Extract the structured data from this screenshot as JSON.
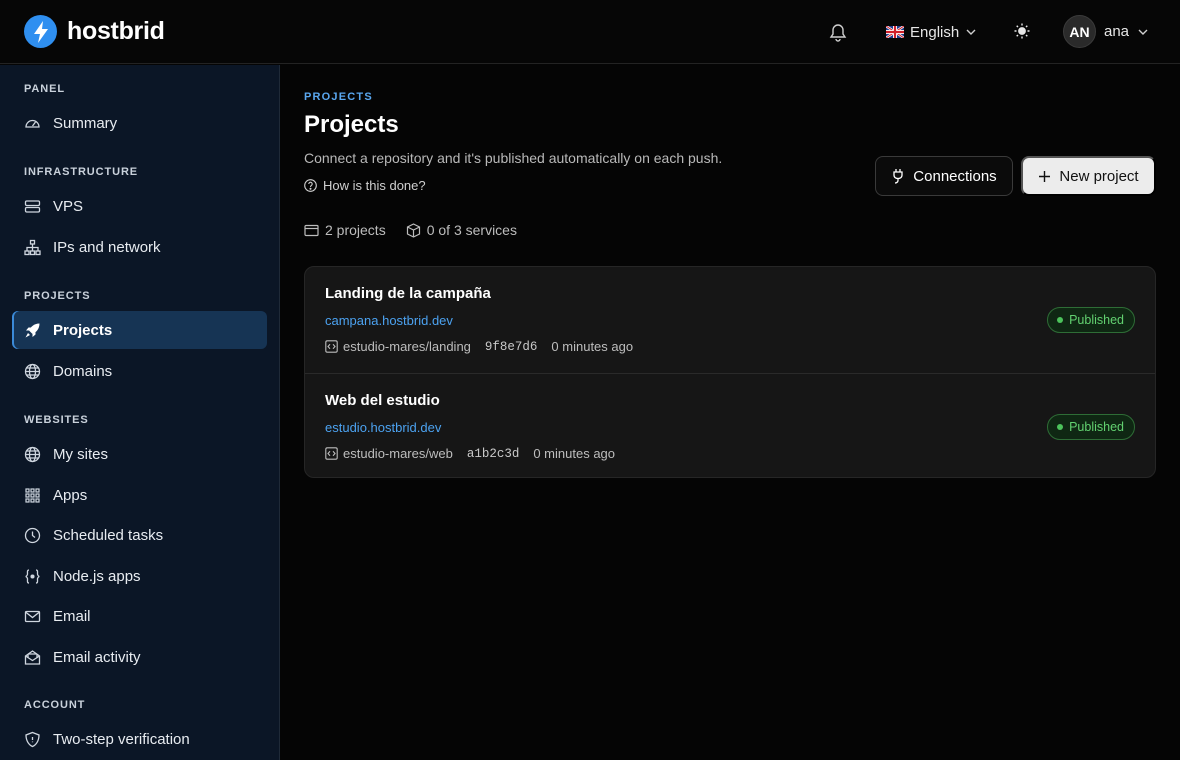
{
  "brand": {
    "name": "hostbrid",
    "color": "#2f8ff0"
  },
  "header": {
    "language": "English",
    "user_initials": "AN",
    "user_name": "ana"
  },
  "sidebar": {
    "sections": [
      {
        "title": "PANEL",
        "items": [
          {
            "label": "Summary",
            "icon": "gauge-icon"
          }
        ]
      },
      {
        "title": "INFRASTRUCTURE",
        "items": [
          {
            "label": "VPS",
            "icon": "server-icon"
          },
          {
            "label": "IPs and network",
            "icon": "network-icon"
          }
        ]
      },
      {
        "title": "PROJECTS",
        "items": [
          {
            "label": "Projects",
            "icon": "rocket-icon",
            "active": true
          },
          {
            "label": "Domains",
            "icon": "globe-icon"
          }
        ]
      },
      {
        "title": "WEBSITES",
        "items": [
          {
            "label": "My sites",
            "icon": "globe-icon"
          },
          {
            "label": "Apps",
            "icon": "grid-icon"
          },
          {
            "label": "Scheduled tasks",
            "icon": "clock-icon"
          },
          {
            "label": "Node.js apps",
            "icon": "braces-icon"
          },
          {
            "label": "Email",
            "icon": "mail-icon"
          },
          {
            "label": "Email activity",
            "icon": "mail-open-icon"
          }
        ]
      },
      {
        "title": "ACCOUNT",
        "items": [
          {
            "label": "Two-step verification",
            "icon": "shield-icon"
          }
        ]
      }
    ]
  },
  "main": {
    "breadcrumb": "PROJECTS",
    "title": "Projects",
    "subtitle": "Connect a repository and it's published automatically on each push.",
    "help_link": "How is this done?",
    "connections_label": "Connections",
    "new_project_label": "New project",
    "stats": {
      "projects": "2 projects",
      "services": "0 of 3 services"
    },
    "projects": [
      {
        "name": "Landing de la campaña",
        "url": "campana.hostbrid.dev",
        "repo": "estudio-mares/landing",
        "commit": "9f8e7d6",
        "time": "0 minutes ago",
        "status": "Published"
      },
      {
        "name": "Web del estudio",
        "url": "estudio.hostbrid.dev",
        "repo": "estudio-mares/web",
        "commit": "a1b2c3d",
        "time": "0 minutes ago",
        "status": "Published"
      }
    ]
  },
  "colors": {
    "accent": "#4ca2f0",
    "success": "#62d170",
    "sidebar_bg": "#0b1626",
    "active_bg": "#163454"
  }
}
